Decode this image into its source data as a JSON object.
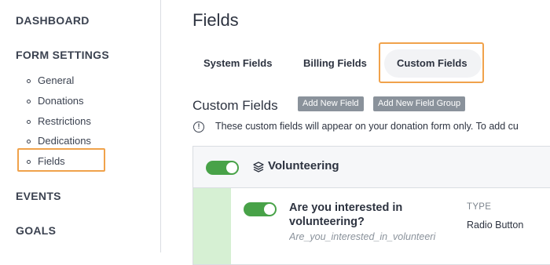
{
  "sidebar": {
    "dashboard": "DASHBOARD",
    "form_settings": "FORM SETTINGS",
    "items": [
      {
        "label": "General"
      },
      {
        "label": "Donations"
      },
      {
        "label": "Restrictions"
      },
      {
        "label": "Dedications"
      },
      {
        "label": "Fields"
      }
    ],
    "events": "EVENTS",
    "goals": "GOALS"
  },
  "main": {
    "title": "Fields",
    "tabs": [
      {
        "label": "System Fields"
      },
      {
        "label": "Billing Fields"
      },
      {
        "label": "Custom Fields"
      }
    ],
    "section_title": "Custom Fields",
    "add_field_label": "Add New Field",
    "add_group_label": "Add New Field Group",
    "info_text": "These custom fields will appear on your donation form only. To add cu",
    "group": {
      "name": "Volunteering",
      "enabled": true,
      "field": {
        "label": "Are you interested in volunteering?",
        "key": "Are_you_interested_in_volunteeri",
        "enabled": true,
        "type_header": "TYPE",
        "type_value": "Radio Button"
      }
    }
  },
  "colors": {
    "highlight": "#f0a24b",
    "toggle_on": "#48a248",
    "button": "#8a929b",
    "accent_strip": "#d6f0d3"
  }
}
